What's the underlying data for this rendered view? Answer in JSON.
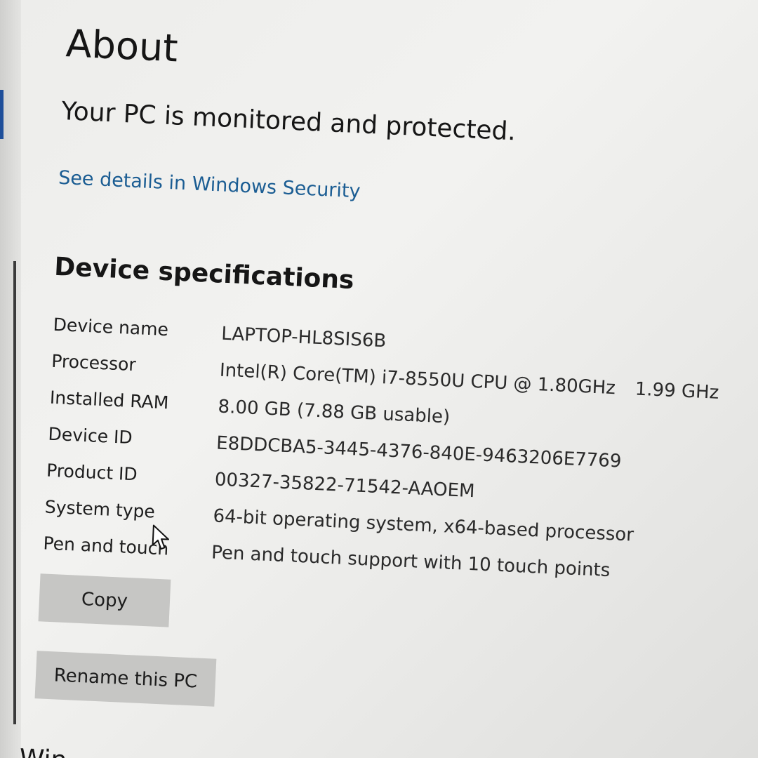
{
  "page": {
    "title": "About",
    "protection_status": "Your PC is monitored and protected.",
    "security_link": "See details in Windows Security"
  },
  "device_specs": {
    "heading": "Device specifications",
    "rows": [
      {
        "label": "Device name",
        "value": "LAPTOP-HL8SIS6B",
        "extra": ""
      },
      {
        "label": "Processor",
        "value": "Intel(R) Core(TM) i7-8550U CPU @ 1.80GHz",
        "extra": "1.99 GHz"
      },
      {
        "label": "Installed RAM",
        "value": "8.00 GB (7.88 GB usable)",
        "extra": ""
      },
      {
        "label": "Device ID",
        "value": "E8DDCBA5-3445-4376-840E-9463206E7769",
        "extra": ""
      },
      {
        "label": "Product ID",
        "value": "00327-35822-71542-AAOEM",
        "extra": ""
      },
      {
        "label": "System type",
        "value": "64-bit operating system, x64-based processor",
        "extra": ""
      },
      {
        "label": "Pen and touch",
        "value": "Pen and touch support with 10 touch points",
        "extra": ""
      }
    ]
  },
  "buttons": {
    "copy": "Copy",
    "rename": "Rename this PC"
  },
  "next_section_partial": "Win",
  "colors": {
    "link": "#1b5d93",
    "button_bg": "#c6c6c4",
    "selection_accent": "#1f4f9a"
  }
}
